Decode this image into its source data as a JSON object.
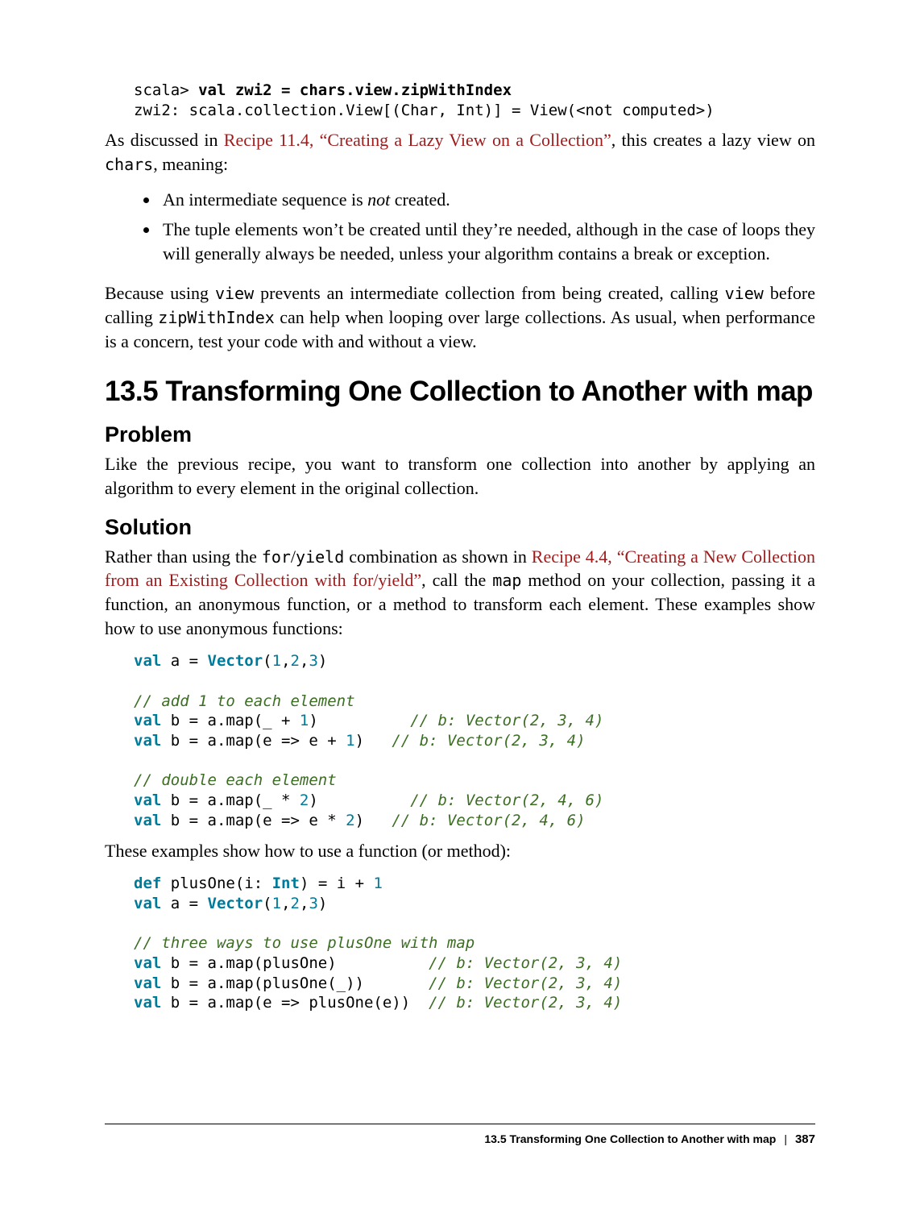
{
  "codeTop": {
    "line1_prompt": "scala> ",
    "line1_bold": "val zwi2 = chars.view.zipWithIndex",
    "line2": "zwi2: scala.collection.View[(Char, Int)] = View(<not computed>)"
  },
  "para1": {
    "t1": "As discussed in ",
    "link": "Recipe 11.4, “Creating a Lazy View on a Collection”",
    "t2": ", this creates a lazy view on ",
    "code": "chars",
    "t3": ", meaning:"
  },
  "bullets": {
    "b1_a": "An intermediate sequence is ",
    "b1_em": "not",
    "b1_b": " created.",
    "b2": "The tuple elements won’t be created until they’re needed, although in the case of loops they will generally always be needed, unless your algorithm contains a break or exception."
  },
  "para2": {
    "t1": "Because using ",
    "c1": "view",
    "t2": " prevents an intermediate collection from being created, calling ",
    "c2": "view",
    "t3": " before calling ",
    "c3": "zipWithIndex",
    "t4": " can help when looping over large collections. As usual, when performance is a concern, test your code with and without a view."
  },
  "heading": "13.5 Transforming One Collection to Another with map",
  "problemHeading": "Problem",
  "problemText": "Like the previous recipe, you want to transform one collection into another by applying an algorithm to every element in the original collection.",
  "solutionHeading": "Solution",
  "solutionPara": {
    "t1": "Rather than using the ",
    "c1": "for",
    "t2": "/",
    "c2": "yield",
    "t3": " combination as shown in ",
    "link": "Recipe 4.4, “Creating a New Collection from an Existing Collection with for/yield”",
    "t4": ", call the ",
    "c3": "map",
    "t5": " method on your collection, passing it a function, an anonymous function, or a method to transform each element. These examples show how to use anonymous functions:"
  },
  "codeA": {
    "kw_val": "val",
    "type_vector": "Vector",
    "kw_def": "def",
    "type_int": "Int",
    "a_eq": " a = ",
    "vec_open": "(",
    "n1": "1",
    "comma": ",",
    "n2": "2",
    "n3": "3",
    "vec_close": ")",
    "cmt_add": "// add 1 to each element",
    "b_eq": " b = a.map(_ + ",
    "one": "1",
    "close_paren": ")",
    "pad1": "          ",
    "cmt_234": "// b: Vector(2, 3, 4)",
    "b_eq2": " b = a.map(e => e + ",
    "pad2": "   ",
    "cmt_double": "// double each element",
    "b_mul": " b = a.map(_ * ",
    "two": "2",
    "cmt_246": "// b: Vector(2, 4, 6)",
    "b_mul2": " b = a.map(e => e * "
  },
  "midPara": "These examples show how to use a function (or method):",
  "codeB": {
    "def_line_a": " plusOne(i: ",
    "def_line_b": ") = i + ",
    "cmt_three": "// three ways to use plusOne with map",
    "l1": " b = a.map(plusOne)          ",
    "l2": " b = a.map(plusOne(_))       ",
    "l3": " b = a.map(e => plusOne(e))  "
  },
  "footer": {
    "title": "13.5 Transforming One Collection to Another with map",
    "page": "387"
  }
}
